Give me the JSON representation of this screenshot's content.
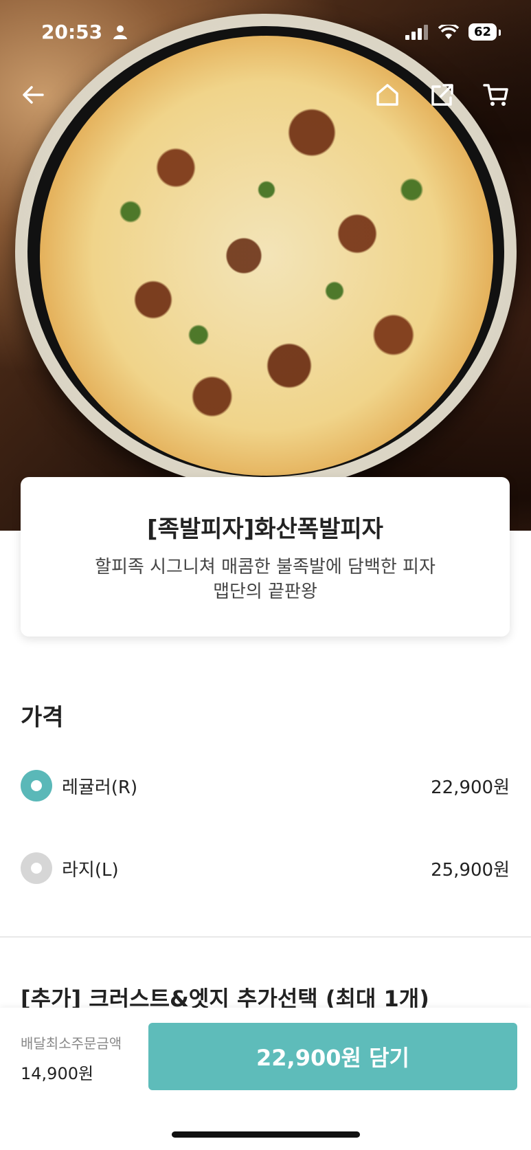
{
  "status_bar": {
    "time": "20:53",
    "battery": "62"
  },
  "icons": {
    "back": "back-arrow-icon",
    "home": "home-icon",
    "share": "share-icon",
    "cart": "cart-icon"
  },
  "product": {
    "name": "[족발피자]화산폭발피자",
    "description_line1": "할피족 시그니쳐 매콤한 불족발에 담백한 피자",
    "description_line2": "맵단의 끝판왕"
  },
  "price_section": {
    "title": "가격",
    "options": [
      {
        "label": "레귤러(R)",
        "price": "22,900원",
        "selected": true
      },
      {
        "label": "라지(L)",
        "price": "25,900원",
        "selected": false
      }
    ]
  },
  "addon_section": {
    "title": "[추가] 크러스트&엣지 추가선택 (최대 1개)"
  },
  "bottom_bar": {
    "min_order_label": "배달최소주문금액",
    "min_order_value": "14,900원",
    "add_button_label": "22,900원 담기"
  },
  "colors": {
    "accent": "#5ebcba",
    "radio_on": "#5ab8b8",
    "radio_off": "#d6d6d6"
  }
}
